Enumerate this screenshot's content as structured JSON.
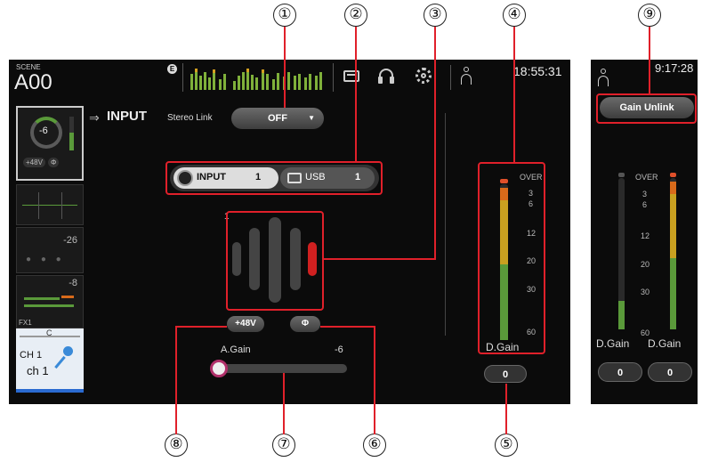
{
  "callouts": [
    "①",
    "②",
    "③",
    "④",
    "⑤",
    "⑥",
    "⑦",
    "⑧",
    "⑨"
  ],
  "header": {
    "scene_label": "SCENE",
    "scene_number": "A00",
    "e_badge": "E",
    "time_main": "18:55:31",
    "time_right": "9:17:28"
  },
  "input_panel": {
    "title": "INPUT",
    "stereo_link_label": "Stereo Link",
    "stereo_link_value": "OFF",
    "source_input_label": "INPUT",
    "source_input_num": "1",
    "source_usb_label": "USB",
    "source_usb_num": "1",
    "channel_num": "1",
    "phantom_label": "+48V",
    "phase_label": "Φ",
    "again_label": "A.Gain",
    "again_value": "-6"
  },
  "meter": {
    "over_label": "OVER",
    "scale": [
      "3",
      "6",
      "12",
      "20",
      "30",
      "60"
    ],
    "dgain_label": "D.Gain",
    "dgain_value": "0"
  },
  "sidebar": {
    "gain_value": "-6",
    "phantom": "+48V",
    "phase": "Φ",
    "level_1": "-26",
    "level_2": "-8",
    "fx_label": "FX1",
    "pan_label": "C",
    "ch_label": "CH 1",
    "ch_name": "ch 1"
  },
  "right_panel": {
    "gain_unlink_label": "Gain Unlink",
    "over_label": "OVER",
    "scale": [
      "3",
      "6",
      "12",
      "20",
      "30",
      "60"
    ],
    "dgain_left_label": "D.Gain",
    "dgain_right_label": "D.Gain",
    "dgain_left_value": "0",
    "dgain_right_value": "0"
  },
  "colors": {
    "accent_red": "#e0202a",
    "meter_green": "#5a9a3a",
    "meter_yellow": "#c9a020",
    "meter_orange": "#d86a1a"
  }
}
